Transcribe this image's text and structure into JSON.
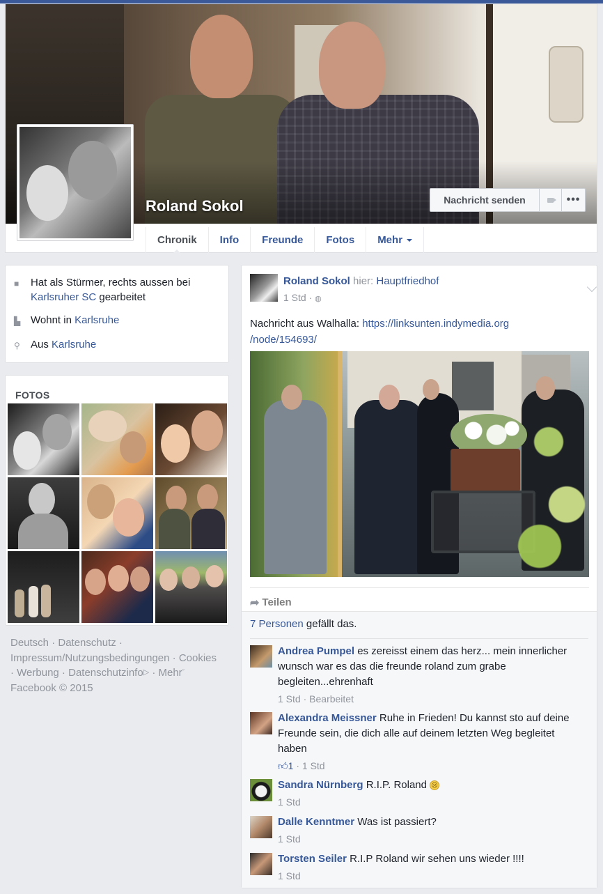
{
  "profile": {
    "name": "Roland Sokol",
    "actions": {
      "message": "Nachricht senden",
      "video_icon": "video-camera-icon",
      "more_icon": "ellipsis-icon"
    },
    "tabs": [
      {
        "label": "Chronik",
        "active": true
      },
      {
        "label": "Info"
      },
      {
        "label": "Freunde"
      },
      {
        "label": "Fotos"
      },
      {
        "label": "Mehr"
      }
    ]
  },
  "intro": {
    "work": {
      "pre": "Hat als Stürmer, rechts aussen bei",
      "link": "Karlsruher SC",
      "post": "gearbeitet"
    },
    "lives": {
      "pre": "Wohnt in",
      "link": "Karlsruhe"
    },
    "from": {
      "pre": "Aus",
      "link": "Karlsruhe"
    }
  },
  "photos": {
    "title": "FOTOS"
  },
  "footer": {
    "links": [
      "Deutsch",
      "Datenschutz",
      "Impressum/Nutzungsbedingungen",
      "Cookies",
      "Werbung",
      "Datenschutzinfo",
      "Mehr"
    ],
    "copyright": "Facebook © 2015"
  },
  "post": {
    "author": "Roland Sokol",
    "location_prefix": "hier:",
    "location": "Hauptfriedhof",
    "time": "1 Std",
    "text_prefix": "Nachricht aus Walhalla:",
    "link_line1": "https://linksunten.indymedia.org",
    "link_line2": "/node/154693/",
    "share": "Teilen",
    "likes_count": "7 Personen",
    "likes_suffix": "gefällt das."
  },
  "comments": [
    {
      "name": "Andrea Pumpel",
      "text": "es zereisst einem das herz... mein innerlicher wunsch war es das die freunde roland zum grabe begleiten...ehrenhaft",
      "time": "1 Std",
      "extra": "Bearbeitet"
    },
    {
      "name": "Alexandra Meissner",
      "text": "Ruhe in Frieden! Du kannst sto auf deine Freunde sein, die dich alle auf deinem letzten Weg begleitet haben",
      "likes": "1",
      "time": "1 Std"
    },
    {
      "name": "Sandra Nürnberg",
      "text": "R.I.P. Roland",
      "time": "1 Std"
    },
    {
      "name": "Dalle Kenntmer",
      "text": "Was ist passiert?",
      "time": "1 Std"
    },
    {
      "name": "Torsten Seiler",
      "text": "R.I.P Roland wir sehen uns wieder !!!!",
      "time": "1 Std"
    }
  ],
  "colors": {
    "brand": "#3b5998",
    "link": "#365899",
    "background": "#e9ebee"
  }
}
